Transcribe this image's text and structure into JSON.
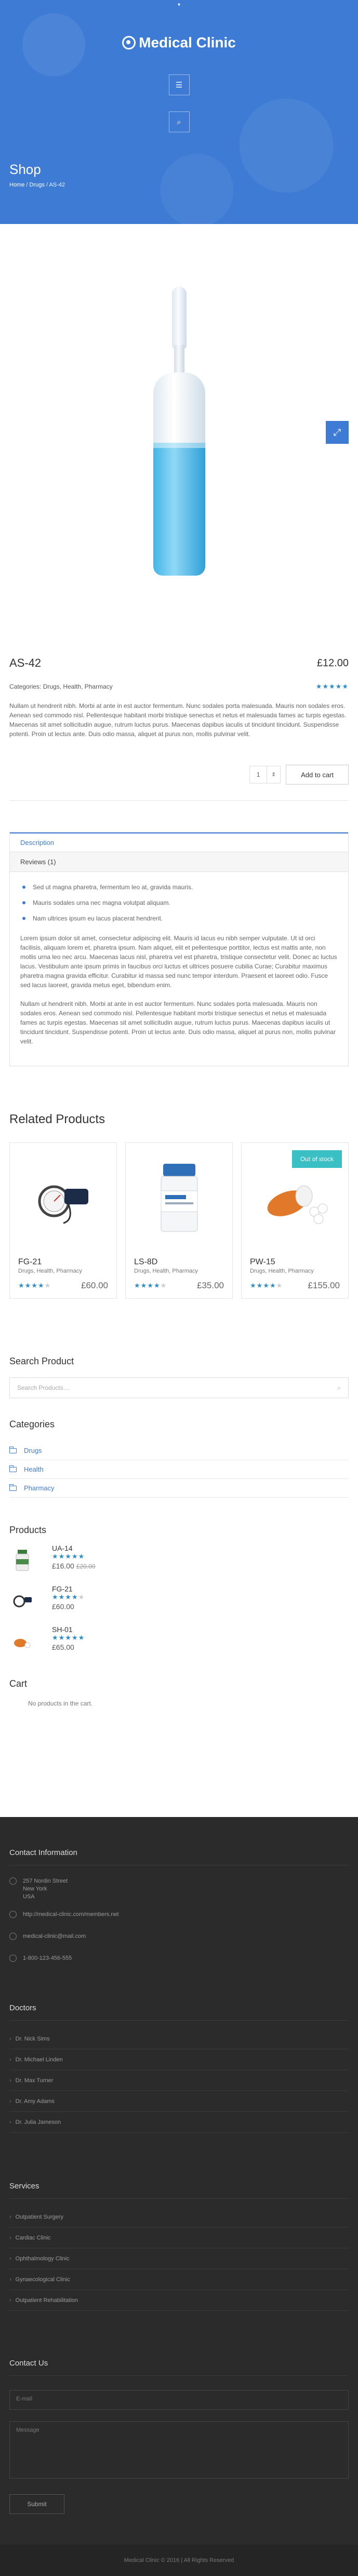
{
  "header": {
    "logo_text": "Medical Clinic",
    "page_title": "Shop",
    "breadcrumb": [
      "Home",
      "Drugs",
      "AS-42"
    ]
  },
  "product": {
    "name": "AS-42",
    "price": "£12.00",
    "categories_label": "Categories:",
    "categories": "Drugs, Health, Pharmacy",
    "rating": 5,
    "description": "Nullam ut hendrerit nibh. Morbi at ante in est auctor fermentum. Nunc sodales porta malesuada. Mauris non sodales eros. Aenean sed commodo nisl. Pellentesque habitant morbi tristique senectus et netus et malesuada fames ac turpis egestas. Maecenas sit amet sollicitudin augue, rutrum luctus purus. Maecenas dapibus iaculis ut tincidunt tincidunt. Suspendisse potenti. Proin ut lectus ante. Duis odio massa, aliquet at purus non, mollis pulvinar velit.",
    "quantity": "1",
    "add_to_cart": "Add to cart"
  },
  "tabs": {
    "description": "Description",
    "reviews": "Reviews (1)",
    "bullets": [
      "Sed ut magna pharetra, fermentum leo at, gravida mauris.",
      "Mauris sodales urna nec magna volutpat aliquam.",
      "Nam ultrices ipsum eu lacus placerat hendrerit."
    ],
    "para1": "Lorem ipsum dolor sit amet, consectetur adipiscing elit. Mauris id lacus eu nibh semper vulputate. Ut id orci facilisis, aliquam lorem et, pharetra ipsum. Nam aliquet, elit et pellentesque porttitor, lectus est mattis ante, non mollis urna leo nec arcu. Maecenas lacus nisl, pharetra vel est pharetra, tristique consectetur velit. Donec ac luctus lacus. Vestibulum ante ipsum primis in faucibus orci luctus et ultrices posuere cubilia Curae; Curabitur maximus pharetra magna gravida efficitur. Curabitur id massa sed nunc tempor interdum. Praesent et laoreet odio. Fusce sed lacus laoreet, gravida metus eget, bibendum enim.",
    "para2": "Nullam ut hendrerit nibh. Morbi at ante in est auctor fermentum. Nunc sodales porta malesuada. Mauris non sodales eros. Aenean sed commodo nisl. Pellentesque habitant morbi tristique senectus et netus et malesuada fames ac turpis egestas. Maecenas sit amet sollicitudin augue, rutrum luctus purus. Maecenas dapibus iaculis ut tincidunt tincidunt. Suspendisse potenti. Proin ut lectus ante. Duis odio massa, aliquet at purus non, mollis pulvinar velit."
  },
  "related": {
    "title": "Related Products",
    "items": [
      {
        "name": "FG-21",
        "cats": "Drugs, Health, Pharmacy",
        "price": "£60.00",
        "rating": 4,
        "badge": ""
      },
      {
        "name": "LS-8D",
        "cats": "Drugs, Health, Pharmacy",
        "price": "£35.00",
        "rating": 4,
        "badge": ""
      },
      {
        "name": "PW-15",
        "cats": "Drugs, Health, Pharmacy",
        "price": "£155.00",
        "rating": 4,
        "badge": "Out of stock"
      }
    ]
  },
  "sidebar": {
    "search_title": "Search Product",
    "search_placeholder": "Search Products…",
    "categories_title": "Categories",
    "categories": [
      "Drugs",
      "Health",
      "Pharmacy"
    ],
    "products_title": "Products",
    "products": [
      {
        "name": "UA-14",
        "price": "£16.00",
        "old_price": "£20.00",
        "rating": 5
      },
      {
        "name": "FG-21",
        "price": "£60.00",
        "old_price": "",
        "rating": 4
      },
      {
        "name": "SH-01",
        "price": "£65.00",
        "old_price": "",
        "rating": 5
      }
    ],
    "cart_title": "Cart",
    "cart_empty": "No products in the cart."
  },
  "footer": {
    "contact_title": "Contact Information",
    "address": [
      "257 Nordin Street",
      "New York",
      "USA"
    ],
    "website": "http://medical-clinic.com/members.net",
    "email": "medical-clinic@mail.com",
    "phone": "1-800-123-456-555",
    "doctors_title": "Doctors",
    "doctors": [
      "Dr. Nick Sims",
      "Dr. Michael Linden",
      "Dr. Max Turner",
      "Dr. Amy Adams",
      "Dr. Julia Jameson"
    ],
    "services_title": "Services",
    "services": [
      "Outpatient Surgery",
      "Cardiac Clinic",
      "Ophthalmology Clinic",
      "Gynaecological Clinic",
      "Outpatient Rehabilitation"
    ],
    "contact_us_title": "Contact Us",
    "email_placeholder": "E-mail",
    "message_placeholder": "Message",
    "submit": "Submit",
    "copyright": "Medical Clinic © 2016 | All Rights Reserved"
  },
  "colors": {
    "primary": "#3e7bd4",
    "footer": "#2b2b2b",
    "badge": "#3abfc4"
  }
}
